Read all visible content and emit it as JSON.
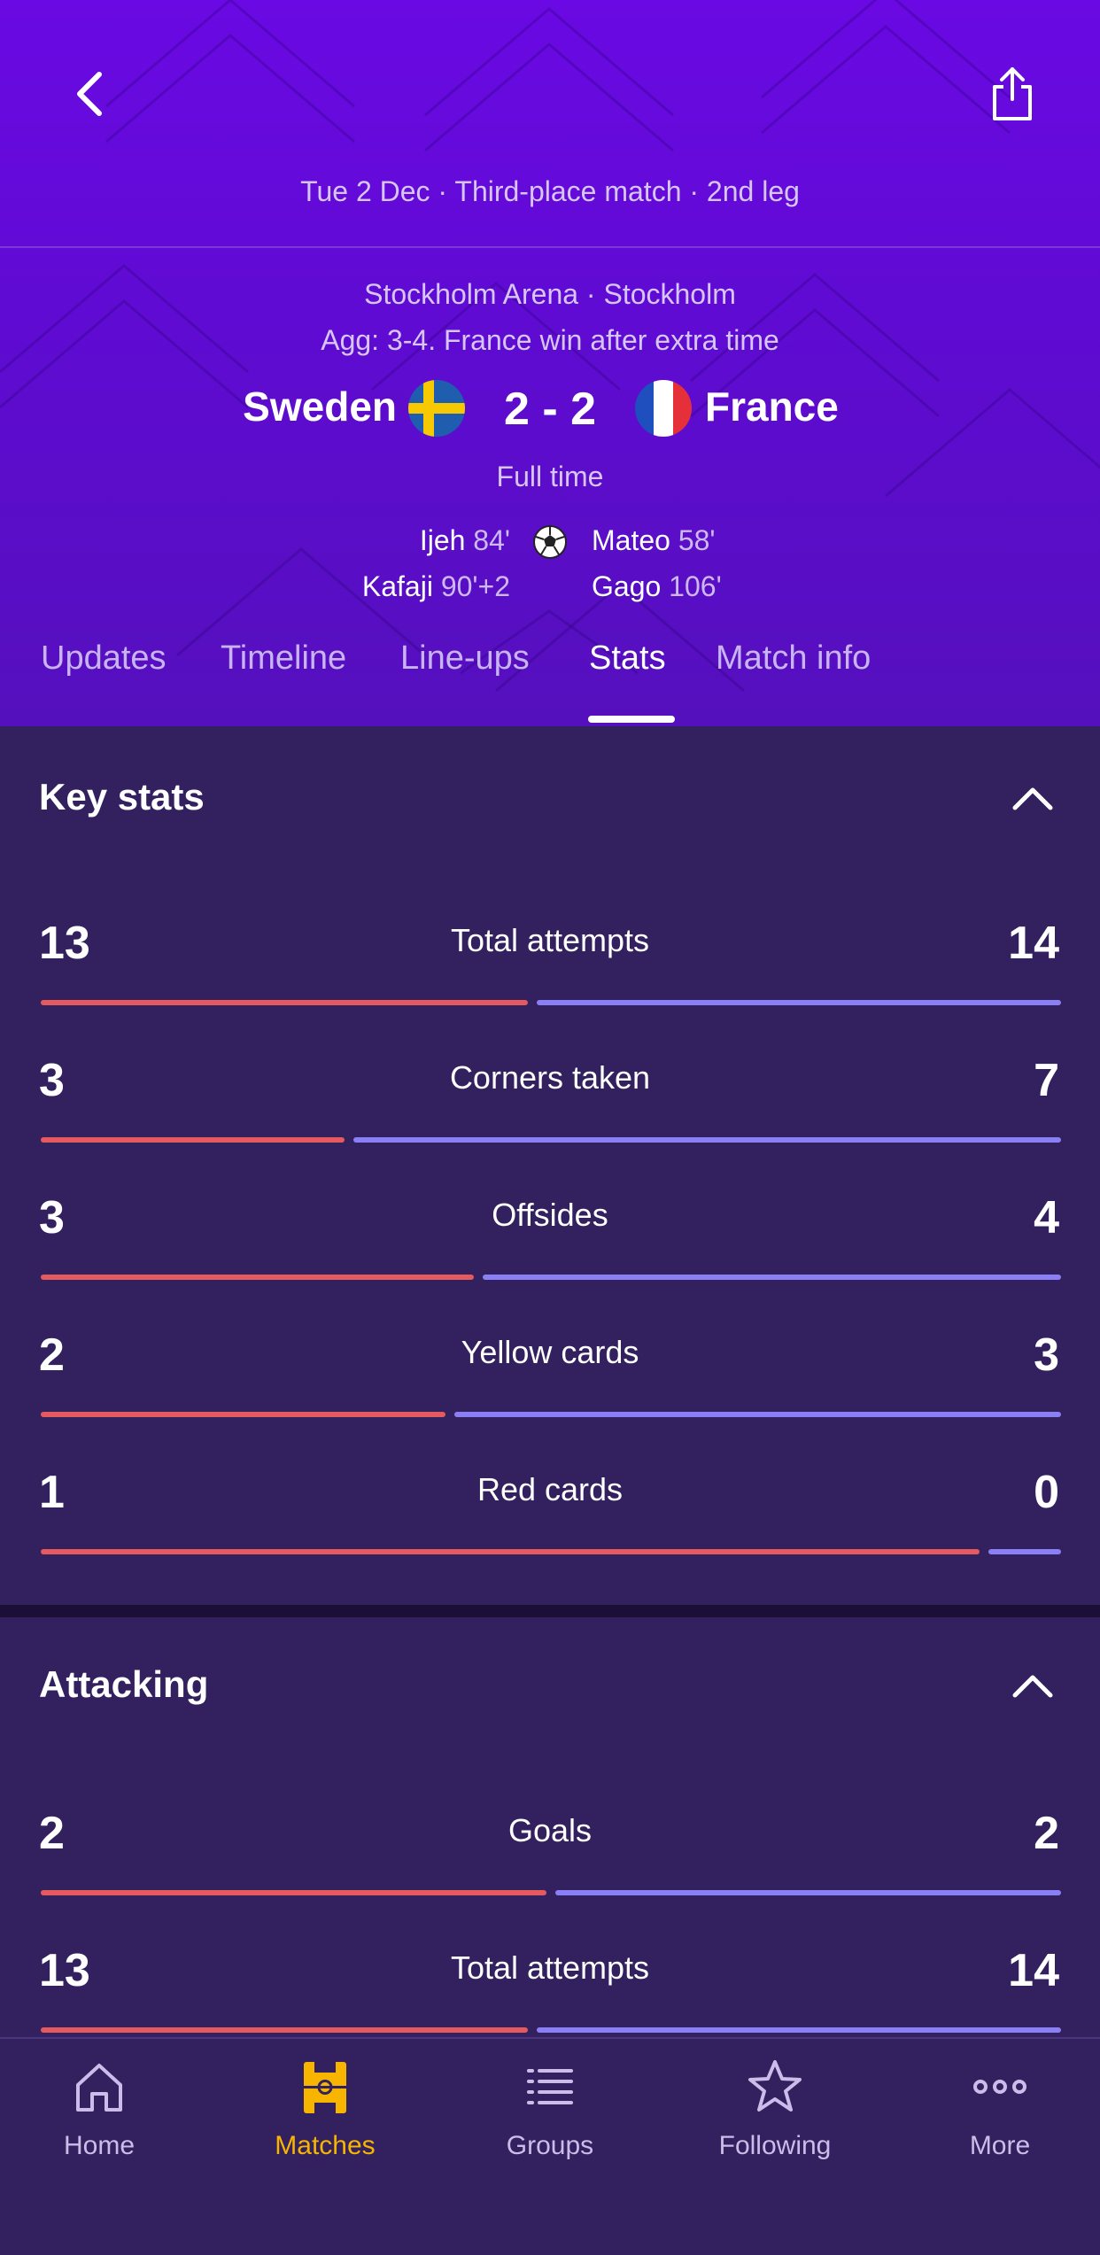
{
  "header": {
    "match_meta": "Tue 2 Dec · Third-place match · 2nd leg",
    "venue": "Stockholm Arena · Stockholm",
    "aggregate": "Agg: 3-4. France win after extra time",
    "home_team": "Sweden",
    "away_team": "France",
    "score": "2 - 2",
    "status": "Full time",
    "home_scorers": [
      {
        "name": "Ijeh",
        "minute": "84'"
      },
      {
        "name": "Kafaji",
        "minute": "90'+2"
      }
    ],
    "away_scorers": [
      {
        "name": "Mateo",
        "minute": "58'"
      },
      {
        "name": "Gago",
        "minute": "106'"
      }
    ]
  },
  "tabs": [
    {
      "label": "Updates",
      "active": false
    },
    {
      "label": "Timeline",
      "active": false
    },
    {
      "label": "Line-ups",
      "active": false
    },
    {
      "label": "Stats",
      "active": true
    },
    {
      "label": "Match info",
      "active": false
    }
  ],
  "key_stats": {
    "title": "Key stats",
    "rows": [
      {
        "label": "Total attempts",
        "home": "13",
        "away": "14"
      },
      {
        "label": "Corners taken",
        "home": "3",
        "away": "7"
      },
      {
        "label": "Offsides",
        "home": "3",
        "away": "4"
      },
      {
        "label": "Yellow cards",
        "home": "2",
        "away": "3"
      },
      {
        "label": "Red cards",
        "home": "1",
        "away": "0"
      }
    ]
  },
  "attacking": {
    "title": "Attacking",
    "rows": [
      {
        "label": "Goals",
        "home": "2",
        "away": "2"
      },
      {
        "label": "Total attempts",
        "home": "13",
        "away": "14"
      }
    ]
  },
  "nav": [
    {
      "label": "Home",
      "icon": "home-icon",
      "active": false
    },
    {
      "label": "Matches",
      "icon": "pitch-icon",
      "active": true
    },
    {
      "label": "Groups",
      "icon": "list-icon",
      "active": false
    },
    {
      "label": "Following",
      "icon": "star-icon",
      "active": false
    },
    {
      "label": "More",
      "icon": "more-dots-icon",
      "active": false
    }
  ],
  "colors": {
    "header_top": "#6a09e3",
    "background": "#33205f",
    "home_bar": "#e45a5f",
    "away_bar": "#8b7ff5",
    "active_nav": "#f7b500"
  }
}
